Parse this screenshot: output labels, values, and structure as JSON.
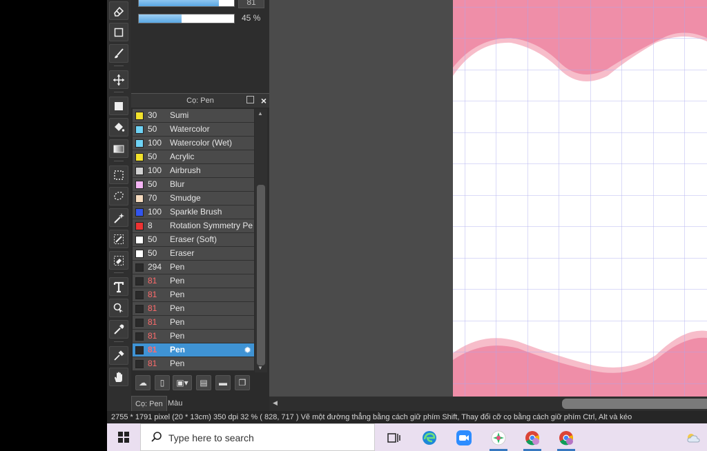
{
  "brush_controls": {
    "size_value": "81",
    "density_value": 0.45,
    "density_label": "45 %"
  },
  "panel": {
    "title": "Cọ: Pen",
    "tabs": [
      "Cọ: Pen",
      "Màu"
    ],
    "brushes": [
      {
        "size": "30",
        "name": "Sumi",
        "color": "#f2e22c",
        "red": false
      },
      {
        "size": "50",
        "name": "Watercolor",
        "color": "#6fd3f5",
        "red": false
      },
      {
        "size": "100",
        "name": "Watercolor (Wet)",
        "color": "#6fd3f5",
        "red": false
      },
      {
        "size": "50",
        "name": "Acrylic",
        "color": "#f2e22c",
        "red": false
      },
      {
        "size": "100",
        "name": "Airbrush",
        "color": "#d2d2d2",
        "red": false
      },
      {
        "size": "50",
        "name": "Blur",
        "color": "#f5b5f5",
        "red": false
      },
      {
        "size": "70",
        "name": "Smudge",
        "color": "#f7dcc0",
        "red": false
      },
      {
        "size": "100",
        "name": "Sparkle Brush",
        "color": "#3355ee",
        "red": false
      },
      {
        "size": "8",
        "name": "Rotation Symmetry Pe",
        "color": "#ee3333",
        "red": false
      },
      {
        "size": "50",
        "name": "Eraser (Soft)",
        "color": "#ffffff",
        "red": false
      },
      {
        "size": "50",
        "name": "Eraser",
        "color": "#ffffff",
        "red": false
      },
      {
        "size": "294",
        "name": "Pen",
        "color": "#2a2a2a",
        "red": false
      },
      {
        "size": "81",
        "name": "Pen",
        "color": "#2a2a2a",
        "red": true
      },
      {
        "size": "81",
        "name": "Pen",
        "color": "#2a2a2a",
        "red": true
      },
      {
        "size": "81",
        "name": "Pen",
        "color": "#2a2a2a",
        "red": true
      },
      {
        "size": "81",
        "name": "Pen",
        "color": "#2a2a2a",
        "red": true
      },
      {
        "size": "81",
        "name": "Pen",
        "color": "#2a2a2a",
        "red": true
      },
      {
        "size": "81",
        "name": "Pen",
        "color": "#2a2a2a",
        "red": true,
        "selected": true
      },
      {
        "size": "81",
        "name": "Pen",
        "color": "#2a2a2a",
        "red": true
      }
    ]
  },
  "status_bar": {
    "text": "2755 * 1791 pixel   (20 * 13cm)  350 dpi   32 %   ( 828, 717 )   Vẽ một đường thẳng bằng cách giữ phím Shift, Thay đổi cỡ cọ bằng cách giữ phím Ctrl, Alt và kéo"
  },
  "taskbar": {
    "search_placeholder": "Type here to search",
    "apps": [
      "task-view-icon",
      "edge-icon",
      "zoom-icon",
      "medibang-icon",
      "chrome-icon",
      "chrome-profile-icon"
    ],
    "weather_icon": "weather-cloud-icon"
  },
  "colors": {
    "canvas_pink": "#ef8ea8",
    "canvas_pink_light": "#f7bdca",
    "grid_line": "#a9a7ee",
    "selected_row": "#3f93d4"
  }
}
